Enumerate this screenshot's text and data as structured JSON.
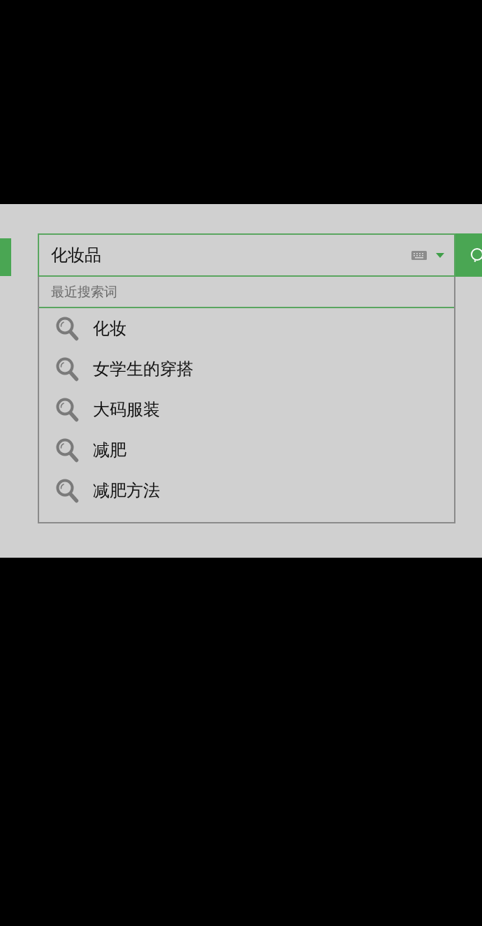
{
  "search": {
    "value": "化妆品"
  },
  "history": {
    "heading": "最近搜索词",
    "items": [
      {
        "text": "化妆"
      },
      {
        "text": "女学生的穿搭"
      },
      {
        "text": "大码服装"
      },
      {
        "text": "减肥"
      },
      {
        "text": "减肥方法"
      }
    ]
  }
}
